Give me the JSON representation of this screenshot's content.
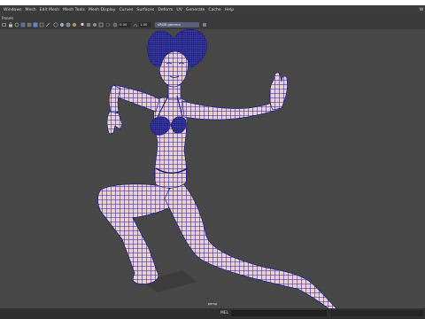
{
  "menubar": {
    "items": [
      "Windows",
      "Mesh",
      "Edit Mesh",
      "Mesh Tools",
      "Mesh Display",
      "Curves",
      "Surfaces",
      "Deform",
      "UV",
      "Generate",
      "Cache",
      "Help"
    ],
    "right_text": "W"
  },
  "panel": {
    "label": "Panels"
  },
  "toolbar": {
    "field_1": "0.00",
    "field_2": "1.00",
    "colorspace": "sRGB gamma"
  },
  "viewport": {
    "camera_label": "persp",
    "mesh_color": "#e8c7cf",
    "wire_color": "#1e1e8c",
    "background_color": "#474747"
  },
  "commandline": {
    "label": "MEL"
  }
}
